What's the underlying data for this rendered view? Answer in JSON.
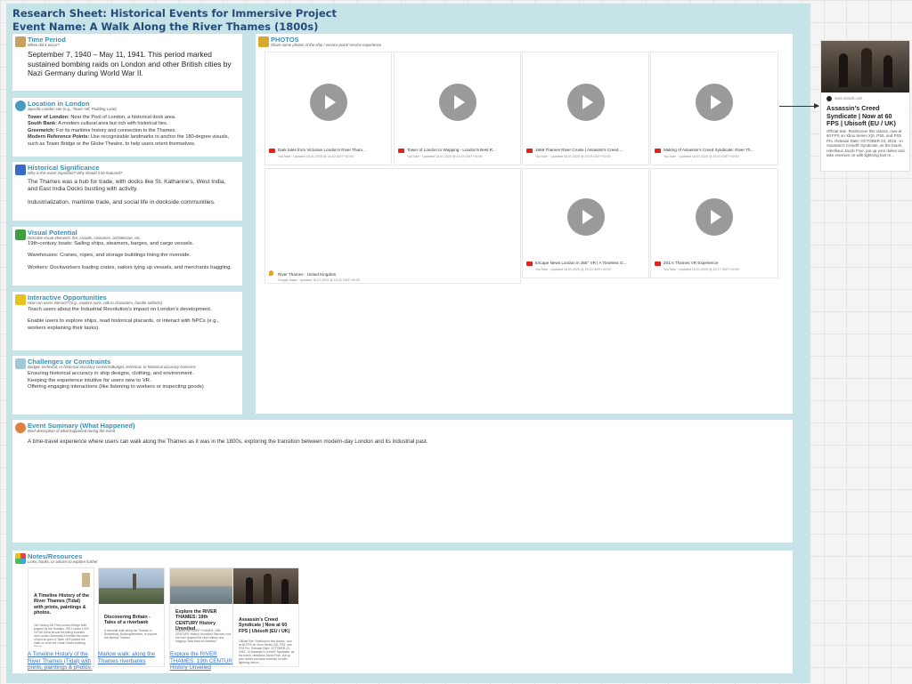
{
  "header": {
    "title_line1": "Research Sheet: Historical Events for Immersive Project",
    "title_line2": "Event Name: A Walk Along the River Thames (1800s)"
  },
  "sections": {
    "time_period": {
      "title": "Time Period",
      "subtitle": "When did it occur?",
      "text": "September 7, 1940 – May 11, 1941. This period marked sustained bombing raids on London and other British cities by Nazi Germany during World War II."
    },
    "location": {
      "title": "Location in London",
      "subtitle": "Specific London site (e.g., Tower Hill, Pudding Lane)",
      "items": [
        {
          "label": "Tower of London:",
          "text": " Near the Pool of London, a historical dock area."
        },
        {
          "label": "South Bank:",
          "text": " A modern cultural area but rich with historical ties."
        },
        {
          "label": "Greenwich:",
          "text": " For its maritime history and connection to the Thames."
        },
        {
          "label": "Modern Reference Points:",
          "text": " Use recognizable landmarks to anchor the 180-degree visuals, such as Tower Bridge or the Globe Theatre, to help users orient themselves."
        }
      ]
    },
    "significance": {
      "title": "Historical Significance",
      "subtitle": "Why is this event important? Why should it be featured?",
      "para1": "The Thames was a hub for trade, with docks like St. Katharine's, West India, and East India Docks bustling with activity.",
      "para2": "Industrialization, maritime trade, and social life in dockside communities."
    },
    "visual": {
      "title": "Visual Potential",
      "subtitle": "Describe visual elements: fire, crowds, costumes, architecture, etc.",
      "para1": "19th-century boats: Sailing ships, steamers, barges, and cargo vessels.",
      "para2": "Warehouses: Cranes, ropes, and storage buildings lining the riverside.",
      "para3": "Workers: Dockworkers loading crates, sailors tying up vessels, and merchants haggling."
    },
    "interactive": {
      "title": "Interactive Opportunities",
      "subtitle": "How can users interact? (e.g., explore ruins, talk to characters, handle artifacts)",
      "para1": "Teach users about the Industrial Revolution's impact on London's development.",
      "para2": "Enable users to explore ships, read historical placards, or interact with NPCs (e.g., workers explaining their tasks)."
    },
    "challenges": {
      "title": "Challenges or Constraints",
      "subtitle": "Budget, technical, or historical accuracy concernsBudget, technical, or historical accuracy concerns",
      "line1": "Ensuring historical accuracy in ship designs, clothing, and environment.",
      "line2": "Keeping the experience intuitive for users new to VR.",
      "line3": "Offering engaging interactions (like listening to workers or inspecting goods)"
    },
    "photos": {
      "title": "PHOTOS",
      "subtitle": "Share some photos of the ship / service point/ service experience"
    },
    "summary": {
      "title": "Event Summary (What Happened)",
      "subtitle": "Brief description of what happened during the event",
      "text": "A time-travel experience where users can walk along the Thames as it was in the 1800s, exploring the transition between modern-day London and its industrial past."
    },
    "notes": {
      "title": "Notes/Resources",
      "subtitle": "Links, books, or articles to explore further"
    }
  },
  "videos": [
    {
      "caption": "Dark tales from Victorian London's River Tham...",
      "meta": "YouTube · Updated 18.01.2025 @ 14:40 GMT+00:00"
    },
    {
      "caption": "Tower of London to Wapping - London's Best R...",
      "meta": "YouTube · Updated 18.01.2025 @ 14:15 GMT+00:00"
    },
    {
      "caption": "1868 Thames River Cruise | Assassin's Creed ...",
      "meta": "YouTube · Updated 18.01.2025 @ 15:05 GMT+00:00"
    },
    {
      "caption": "Making of Assassin's Creed Syndicate: River Th...",
      "meta": "YouTube · Updated 18.01.2025 @ 15:00 GMT+00:00"
    },
    {
      "caption": "Escape News London in 360° VR | A Timeless G...",
      "meta": "YouTube · Updated 18.01.2025 @ 15:13 GMT+00:00"
    },
    {
      "caption": "ZSL's Thames VR Experience",
      "meta": "YouTube · Updated 18.01.2025 @ 15:17 GMT+00:00"
    }
  ],
  "map_embed": {
    "caption": "River Thames · United Kingdom",
    "meta": "Google Maps · Updated 18.01.2025 @ 15:22 GMT+00:00"
  },
  "side_card": {
    "source": "www.ubisoft.com",
    "title": "Assassin's Creed Syndicate | Now at 60 FPS | Ubisoft (EU / UK)",
    "desc": "Official Site. Rediscover this classic, now at 60 FPS on Xbox Series X|S, PS5, and PS5 Pro. Release Date: OCTOBER 23, 2015 - In Assassin's Creed® Syndicate, as the brash, rebellious Jacob Frye, put up your dukes and take enemies on with lightning fast re..."
  },
  "resources": [
    {
      "title": "A Timeline History of the River Thames (Tidal) with prints, paintings & photos.",
      "desc": "1st Century AD First London Bridge built, shaped by the Romans. 993 London's 900 Of Fall Great shows the killing invaders and London Stonewall a fortified the tower of lyed at open of Table 16% placed the elder on of all the Great Oxford building, Slingo...",
      "link": "A Timeline History of the River Thames (Tidal) with prints, paintings & photos."
    },
    {
      "title": "Discovering Britain - Tales of a riverbank",
      "desc": "A riverside walk along the Thames in Bucklebury, Buckinghamshire, to explore the Marlow Thames",
      "link": "Marlow walk: along the Thames riverbanks"
    },
    {
      "title": "Explore the RIVER THAMES: 19th CENTURY History Unveiled",
      "desc": "Explore the RIVER THAMES: 19th CENTURY History Unveiled! Discover how the river shaped the city's history and imagery. Start their full timeline!",
      "link": "Explore the RIVER THAMES: 19th CENTURY History Unveiled"
    },
    {
      "title": "Assassin's Creed Syndicate | Now at 60 FPS | Ubisoft (EU / UK)",
      "desc": "Official Site. Rediscover this classic, now at 60 FPS on Xbox Series X|S, PS5, and PS5 Pro. Release Date: OCTOBER 23, 2015 - In Assassin's Creed® Syndicate, as the brash, rebellious Jacob Frye, put up your dukes and take enemies on with lightning fast re...",
      "link": ""
    }
  ]
}
